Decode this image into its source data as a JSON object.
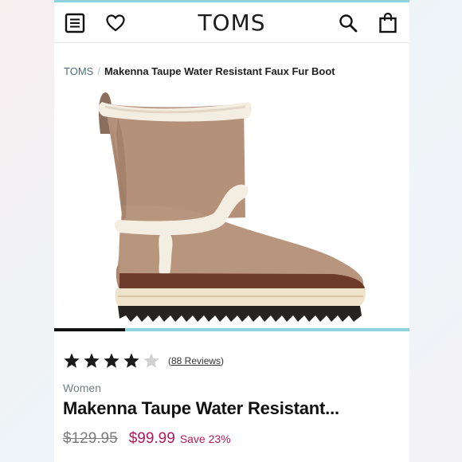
{
  "header": {
    "logo": "TOMS",
    "icons": [
      "menu-icon",
      "heart-icon",
      "search-icon",
      "bag-icon"
    ]
  },
  "breadcrumb": {
    "root": "TOMS",
    "separator": "/",
    "current": "Makenna Taupe Water Resistant Faux Fur Boot"
  },
  "gallery": {
    "progress_fraction": 0.2
  },
  "product": {
    "rating": 4,
    "rating_max": 5,
    "reviews_open": "(",
    "reviews_link": "88 Reviews",
    "reviews_close": ")",
    "category": "Women",
    "title": "Makenna Taupe Water Resistant...",
    "original_price": "$129.95",
    "sale_price": "$99.99",
    "savings": "Save 23%"
  },
  "colors": {
    "accent": "#8fd3df",
    "sale": "#b5165b",
    "star_filled": "#1a1a1a",
    "star_empty": "#d0d0d0"
  }
}
